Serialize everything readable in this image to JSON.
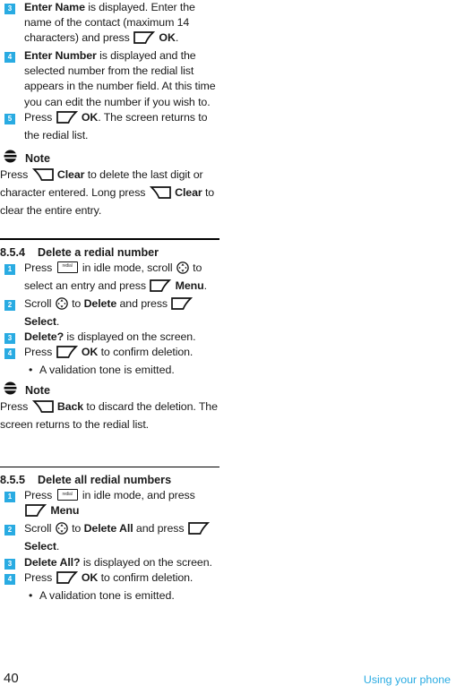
{
  "page": {
    "number": "40",
    "footer_title": "Using your phone"
  },
  "icons": {
    "left_softkey": "left-softkey-icon",
    "right_softkey": "right-softkey-icon",
    "navigation": "scroll-navigation-icon",
    "redial": "redial-key-icon",
    "note": "note-icon"
  },
  "top_steps": [
    {
      "number": "3",
      "parts": [
        {
          "t": "Enter Name",
          "b": true
        },
        {
          "t": " is displayed. Enter the name of the contact (maximum 14 characters) and press ",
          "b": false
        },
        {
          "t": "KEY_LEFT_SOFT",
          "b": false
        },
        {
          "t": " OK",
          "b": true
        },
        {
          "t": ".",
          "b": false
        }
      ]
    },
    {
      "number": "4",
      "parts": [
        {
          "t": "Enter Number",
          "b": true
        },
        {
          "t": " is displayed and the selected number from the redial list appears in the number field. At this time you can edit the number if you wish to.",
          "b": false
        }
      ]
    },
    {
      "number": "5",
      "parts": [
        {
          "t": "Press ",
          "b": false
        },
        {
          "t": "KEY_LEFT_SOFT",
          "b": false
        },
        {
          "t": " OK",
          "b": true
        },
        {
          "t": ". The screen returns to the redial list.",
          "b": false
        }
      ]
    }
  ],
  "note1": {
    "label": "Note",
    "parts": [
      {
        "t": "Press ",
        "b": false
      },
      {
        "t": "KEY_RIGHT_SOFT",
        "b": false
      },
      {
        "t": " Clear",
        "b": true
      },
      {
        "t": " to delete the last digit or character entered. Long press ",
        "b": false
      },
      {
        "t": "KEY_RIGHT_SOFT",
        "b": false
      },
      {
        "t": " Clear",
        "b": true
      },
      {
        "t": " to clear the entire entry.",
        "b": false
      }
    ]
  },
  "section_854": {
    "number": "8.5.4",
    "title": "Delete a redial number",
    "steps": [
      {
        "number": "1",
        "parts": [
          {
            "t": "Press ",
            "b": false
          },
          {
            "t": "KEY_REDIAL",
            "b": false
          },
          {
            "t": " in idle mode, scroll ",
            "b": false
          },
          {
            "t": "KEY_NAV",
            "b": false
          },
          {
            "t": " to select an entry and press ",
            "b": false
          },
          {
            "t": "KEY_LEFT_SOFT",
            "b": false
          },
          {
            "t": " Menu",
            "b": true
          },
          {
            "t": ".",
            "b": false
          }
        ]
      },
      {
        "number": "2",
        "parts": [
          {
            "t": "Scroll ",
            "b": false
          },
          {
            "t": "KEY_NAV",
            "b": false
          },
          {
            "t": " to ",
            "b": false
          },
          {
            "t": "Delete",
            "b": true
          },
          {
            "t": " and press ",
            "b": false
          },
          {
            "t": "KEY_LEFT_SOFT",
            "b": false
          },
          {
            "t": " Select",
            "b": true
          },
          {
            "t": ".",
            "b": false
          }
        ]
      },
      {
        "number": "3",
        "parts": [
          {
            "t": "Delete?",
            "b": true
          },
          {
            "t": " is displayed on the screen.",
            "b": false
          }
        ]
      },
      {
        "number": "4",
        "parts": [
          {
            "t": "Press ",
            "b": false
          },
          {
            "t": "KEY_LEFT_SOFT",
            "b": false
          },
          {
            "t": " OK",
            "b": true
          },
          {
            "t": " to confirm deletion.",
            "b": false
          }
        ]
      }
    ],
    "bullet": "A validation tone is emitted.",
    "bullet_dot": "•"
  },
  "note2": {
    "label": "Note",
    "parts": [
      {
        "t": "Press ",
        "b": false
      },
      {
        "t": "KEY_RIGHT_SOFT",
        "b": false
      },
      {
        "t": " Back",
        "b": true
      },
      {
        "t": " to discard the deletion. The screen returns to the redial list.",
        "b": false
      }
    ]
  },
  "section_855": {
    "number": "8.5.5",
    "title": "Delete all redial numbers",
    "steps": [
      {
        "number": "1",
        "parts": [
          {
            "t": "Press ",
            "b": false
          },
          {
            "t": "KEY_REDIAL",
            "b": false
          },
          {
            "t": " in idle mode, and press ",
            "b": false
          },
          {
            "t": "KEY_LEFT_SOFT",
            "b": false
          },
          {
            "t": " Menu",
            "b": true
          }
        ]
      },
      {
        "number": "2",
        "parts": [
          {
            "t": "Scroll ",
            "b": false
          },
          {
            "t": "KEY_NAV",
            "b": false
          },
          {
            "t": " to ",
            "b": false
          },
          {
            "t": "Delete All",
            "b": true
          },
          {
            "t": " and press ",
            "b": false
          },
          {
            "t": "KEY_LEFT_SOFT",
            "b": false
          },
          {
            "t": " Select",
            "b": true
          },
          {
            "t": ".",
            "b": false
          }
        ]
      },
      {
        "number": "3",
        "parts": [
          {
            "t": "Delete All?",
            "b": true
          },
          {
            "t": " is displayed on the screen.",
            "b": false
          }
        ]
      },
      {
        "number": "4",
        "parts": [
          {
            "t": "Press ",
            "b": false
          },
          {
            "t": "KEY_LEFT_SOFT",
            "b": false
          },
          {
            "t": " OK",
            "b": true
          },
          {
            "t": " to confirm deletion.",
            "b": false
          }
        ]
      }
    ],
    "bullet": "A validation tone is emitted.",
    "bullet_dot": "•"
  },
  "redial_key_label": "redial",
  "colors": {
    "accent_blue": "#29abe2",
    "text": "#1a1a1a"
  }
}
